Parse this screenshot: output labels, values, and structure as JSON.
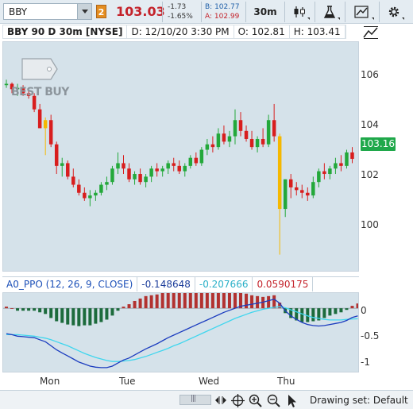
{
  "toolbar": {
    "symbol": "BBY",
    "badge": "2",
    "last_price": "103.03",
    "net_change": "-1.73",
    "pct_change": "-1.65%",
    "bid": "B: 102.77",
    "ask": "A: 102.99",
    "timeframe": "30m"
  },
  "header": {
    "title": "BBY 90 D 30m [NYSE]",
    "date": "D: 12/10/20 3:30 PM",
    "open": "O: 102.81",
    "high": "H: 103.41"
  },
  "price_axis": {
    "labels": [
      "106",
      "104",
      "102",
      "100"
    ],
    "current_price": "103.16",
    "current_color": "#1fa84a"
  },
  "logo": {
    "text": "BEST BUY"
  },
  "indicator": {
    "name": "A0_PPO (12, 26, 9, CLOSE)",
    "value1": "-0.148648",
    "value2": "-0.207666",
    "value3": "0.0590175",
    "axis_labels": [
      "0",
      "-0.5",
      "-1"
    ]
  },
  "x_axis": {
    "labels": [
      "Mon",
      "Tue",
      "Wed",
      "Thu"
    ]
  },
  "bottom_bar": {
    "drawing_set": "Drawing set: Default"
  },
  "colors": {
    "up": "#23a83a",
    "down": "#d81e1e",
    "highlight": "#f5b800",
    "ppo_line": "#1b3cbf",
    "signal_line": "#3fd6ee",
    "hist_up": "#b23230",
    "hist_down": "#1c6b3c"
  },
  "chart_data": {
    "type": "candlestick",
    "price_ylim": [
      99,
      107.5
    ],
    "candles": [
      [
        105.9,
        106.1,
        105.8,
        105.95
      ],
      [
        105.95,
        106.0,
        105.6,
        105.75
      ],
      [
        105.75,
        105.95,
        105.5,
        105.8
      ],
      [
        105.8,
        105.9,
        105.5,
        105.6
      ],
      [
        105.6,
        105.7,
        105.4,
        105.5
      ],
      [
        105.5,
        105.6,
        104.9,
        105.0
      ],
      [
        105.0,
        105.2,
        104.3,
        104.3
      ],
      [
        104.3,
        104.7,
        103.3,
        104.6
      ],
      [
        104.6,
        104.8,
        103.6,
        103.7
      ],
      [
        103.7,
        103.8,
        102.6,
        102.9
      ],
      [
        102.9,
        103.2,
        102.5,
        103.0
      ],
      [
        103.0,
        103.1,
        102.4,
        102.5
      ],
      [
        102.5,
        102.8,
        102.1,
        102.2
      ],
      [
        102.2,
        102.4,
        101.8,
        101.9
      ],
      [
        101.9,
        102.1,
        101.6,
        101.7
      ],
      [
        101.7,
        102.0,
        101.4,
        101.8
      ],
      [
        101.8,
        102.0,
        101.6,
        101.9
      ],
      [
        101.9,
        102.3,
        101.8,
        102.2
      ],
      [
        102.2,
        102.5,
        102.0,
        102.3
      ],
      [
        102.3,
        102.9,
        102.2,
        102.8
      ],
      [
        102.8,
        103.4,
        102.6,
        103.0
      ],
      [
        103.0,
        103.3,
        102.6,
        102.8
      ],
      [
        102.8,
        103.0,
        102.3,
        102.4
      ],
      [
        102.4,
        102.7,
        102.2,
        102.6
      ],
      [
        102.6,
        102.8,
        102.2,
        102.3
      ],
      [
        102.3,
        102.6,
        102.1,
        102.5
      ],
      [
        102.5,
        102.9,
        102.3,
        102.8
      ],
      [
        102.8,
        103.0,
        102.5,
        102.7
      ],
      [
        102.7,
        102.9,
        102.5,
        102.8
      ],
      [
        102.8,
        103.1,
        102.6,
        103.0
      ],
      [
        103.0,
        103.2,
        102.7,
        102.9
      ],
      [
        102.9,
        103.1,
        102.6,
        102.7
      ],
      [
        102.7,
        103.0,
        102.5,
        102.9
      ],
      [
        102.9,
        103.3,
        102.8,
        103.2
      ],
      [
        103.2,
        103.4,
        102.9,
        103.0
      ],
      [
        103.0,
        103.6,
        102.9,
        103.5
      ],
      [
        103.5,
        103.9,
        103.3,
        103.7
      ],
      [
        103.7,
        104.0,
        103.4,
        103.6
      ],
      [
        103.6,
        104.3,
        103.5,
        104.1
      ],
      [
        104.1,
        104.4,
        103.7,
        103.8
      ],
      [
        103.8,
        104.2,
        103.6,
        104.0
      ],
      [
        104.0,
        105.0,
        103.7,
        104.6
      ],
      [
        104.6,
        104.9,
        104.0,
        104.2
      ],
      [
        104.2,
        104.4,
        103.8,
        103.9
      ],
      [
        103.9,
        104.2,
        103.5,
        103.6
      ],
      [
        103.6,
        104.0,
        103.4,
        103.9
      ],
      [
        103.9,
        104.3,
        103.6,
        103.7
      ],
      [
        103.7,
        104.8,
        103.6,
        104.6
      ],
      [
        104.6,
        105.2,
        103.8,
        104.0
      ],
      [
        104.0,
        104.1,
        99.6,
        101.3
      ],
      [
        101.3,
        102.4,
        101.0,
        102.4
      ],
      [
        102.4,
        102.6,
        101.7,
        102.1
      ],
      [
        102.1,
        102.3,
        101.8,
        102.0
      ],
      [
        102.0,
        102.2,
        101.7,
        101.9
      ],
      [
        101.9,
        102.1,
        101.6,
        101.8
      ],
      [
        101.8,
        102.5,
        101.7,
        102.3
      ],
      [
        102.3,
        102.8,
        102.1,
        102.7
      ],
      [
        102.7,
        103.0,
        102.4,
        102.6
      ],
      [
        102.6,
        102.9,
        102.4,
        102.8
      ],
      [
        102.8,
        103.2,
        102.6,
        103.0
      ],
      [
        103.0,
        103.3,
        102.7,
        102.9
      ],
      [
        102.9,
        103.5,
        102.8,
        103.4
      ],
      [
        103.4,
        103.6,
        103.0,
        103.16
      ]
    ],
    "highlight_bars": [
      7,
      49
    ],
    "ppo": [
      -0.5,
      -0.52,
      -0.55,
      -0.56,
      -0.57,
      -0.58,
      -0.62,
      -0.66,
      -0.74,
      -0.82,
      -0.88,
      -0.94,
      -1.0,
      -1.06,
      -1.1,
      -1.14,
      -1.16,
      -1.17,
      -1.17,
      -1.14,
      -1.08,
      -1.02,
      -0.98,
      -0.92,
      -0.86,
      -0.8,
      -0.75,
      -0.7,
      -0.64,
      -0.58,
      -0.53,
      -0.48,
      -0.43,
      -0.38,
      -0.33,
      -0.28,
      -0.23,
      -0.18,
      -0.13,
      -0.08,
      -0.04,
      0.0,
      0.04,
      0.06,
      0.08,
      0.1,
      0.12,
      0.15,
      0.18,
      0.1,
      -0.05,
      -0.15,
      -0.22,
      -0.28,
      -0.32,
      -0.34,
      -0.35,
      -0.34,
      -0.32,
      -0.3,
      -0.28,
      -0.24,
      -0.18,
      -0.148648
    ],
    "signal": [
      -0.52,
      -0.52,
      -0.52,
      -0.53,
      -0.54,
      -0.55,
      -0.57,
      -0.59,
      -0.62,
      -0.66,
      -0.7,
      -0.74,
      -0.79,
      -0.84,
      -0.89,
      -0.93,
      -0.97,
      -1.0,
      -1.03,
      -1.05,
      -1.05,
      -1.04,
      -1.03,
      -1.01,
      -0.98,
      -0.95,
      -0.91,
      -0.87,
      -0.83,
      -0.79,
      -0.74,
      -0.7,
      -0.65,
      -0.6,
      -0.55,
      -0.5,
      -0.45,
      -0.4,
      -0.35,
      -0.3,
      -0.25,
      -0.2,
      -0.16,
      -0.12,
      -0.08,
      -0.05,
      -0.02,
      0.0,
      0.02,
      0.03,
      0.01,
      -0.03,
      -0.07,
      -0.11,
      -0.15,
      -0.18,
      -0.2,
      -0.22,
      -0.23,
      -0.23,
      -0.23,
      -0.22,
      -0.21,
      -0.207666
    ],
    "ppo_ylim": [
      -1.25,
      0.3
    ]
  }
}
